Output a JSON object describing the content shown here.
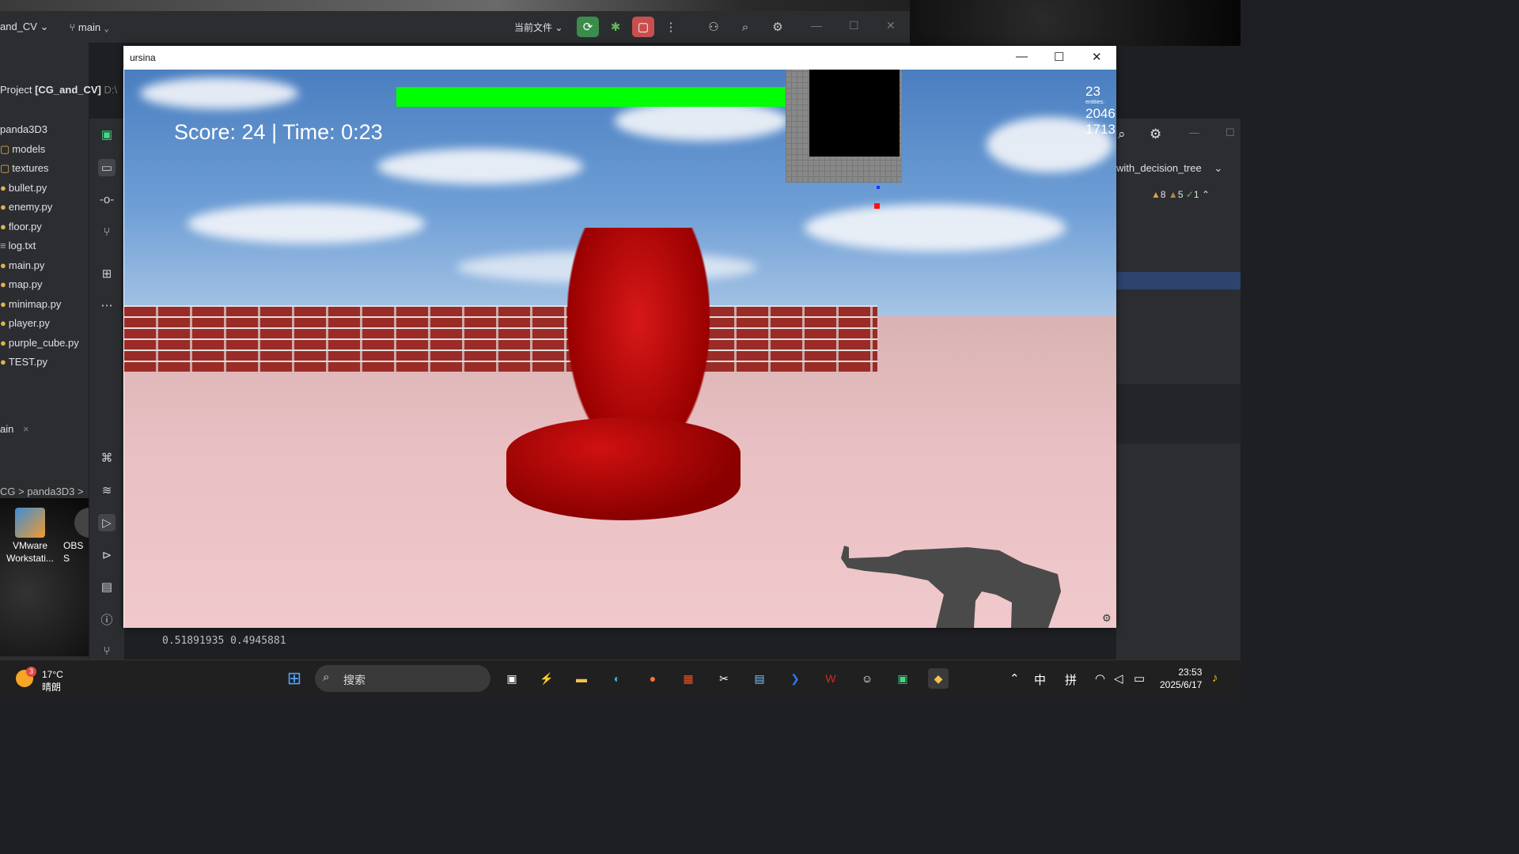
{
  "ide": {
    "project_name": "and_CV",
    "branch": "main",
    "run_config": "当前文件",
    "project_panel_title": "Project",
    "project_root": "[CG_and_CV]",
    "project_path": "D:\\",
    "tree": [
      "panda3D3",
      "models",
      "textures",
      "bullet.py",
      "enemy.py",
      "floor.py",
      "log.txt",
      "main.py",
      "map.py",
      "minimap.py",
      "player.py",
      "purple_cube.py",
      "TEST.py"
    ],
    "run_tab": "ain",
    "breadcrumb_1": "CG",
    "breadcrumb_2": "panda3D3",
    "right_file": "with_decision_tree",
    "inspections": {
      "warnings_strong": "8",
      "warnings_weak": "5",
      "ok": "1"
    },
    "console_line": "0.51891935 0.4945881"
  },
  "desktop_icons": [
    {
      "label": "VMware Workstati..."
    },
    {
      "label": "OBS S"
    }
  ],
  "game_window": {
    "title": "ursina",
    "hud": {
      "score_text": "Score: 24 | Time: 0:23",
      "health_fraction": 1.0,
      "health_color": "#00ff00",
      "fps": "23",
      "stat_label_1": "entities:",
      "stat_value_1": "2046",
      "stat_value_2": "1713"
    }
  },
  "taskbar": {
    "weather_temp": "17°C",
    "weather_desc": "晴朗",
    "weather_badge": "3",
    "search_placeholder": "搜索",
    "ime_1": "中",
    "ime_2": "拼",
    "time": "23:53",
    "date": "2025/6/17"
  }
}
